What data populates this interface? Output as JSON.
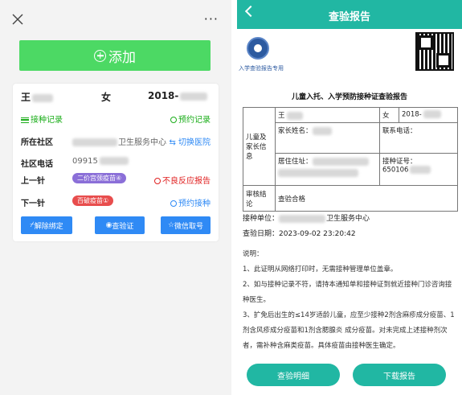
{
  "left": {
    "more_label": "···",
    "add_label": "添加",
    "card": {
      "name": "王",
      "gender": "女",
      "dob": "2018-",
      "vaccine_record": "接种记录",
      "appointment_record": "预约记录",
      "community_label": "所在社区",
      "community_value": "卫生服务中心",
      "switch_hospital": "切换医院",
      "phone_label": "社区电话",
      "phone_value": "09915",
      "prev_label": "上一针",
      "prev_badge": "二价宫颈疫苗④",
      "adverse_report": "不良反应报告",
      "next_label": "下一针",
      "next_badge": "百破疫苗①",
      "appointment": "预约接种",
      "btn_unbind": "解除绑定",
      "btn_check": "查验证",
      "btn_wechat": "微信取号"
    }
  },
  "right": {
    "header_title": "查验报告",
    "emblem_caption": "入学查验报告专用",
    "cert_title": "儿童入托、入学预防接种证查验报告",
    "table": {
      "name": "王",
      "gender": "女",
      "dob": "2018-",
      "child_info": "儿童及家长信息",
      "guardian_label": "家长姓名：",
      "contact_label": "联系电话：",
      "address_label": "居住住址：",
      "cert_no_label": "接种证号：",
      "cert_no_value": "650106",
      "audit_label": "审核结论",
      "audit_value": "查验合格"
    },
    "unit_label": "接种单位：",
    "unit_value": "卫生服务中心",
    "date_text": "查验日期：2023-09-02 23:20:42",
    "notes": [
      "说明：",
      "1、此证明从网络打印时，无需接种管理单位盖章。",
      "2、如与接种记录不符，请持本通知单和接种证到就近接种门诊咨询接种医生。",
      "3、扩免后出生的≤14岁适龄儿童，应至少接种2剂含麻疹成分疫苗、1剂含风疹成分疫苗和1剂含腮腺炎 成分疫苗。对未完成上述接种剂次者，需补种含麻类疫苗。具体疫苗由接种医生确定。"
    ],
    "btn_detail": "查验明细",
    "btn_download": "下载报告"
  },
  "colors": {
    "green": "#4cd964",
    "teal": "#21b7a3",
    "blue": "#2f8af5",
    "red": "#e02020",
    "purple": "#8b6fd8"
  }
}
